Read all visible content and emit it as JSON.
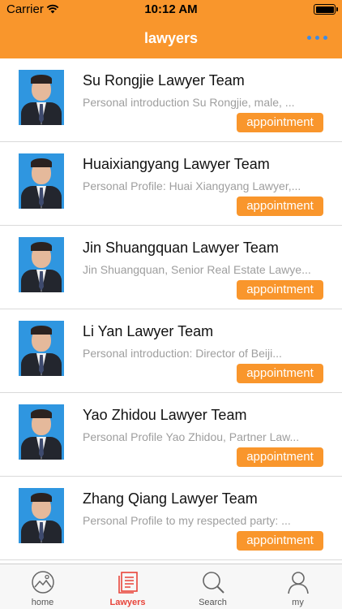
{
  "status_bar": {
    "carrier": "Carrier",
    "time": "10:12 AM"
  },
  "nav": {
    "title": "lawyers",
    "more_icon": "ellipsis-icon"
  },
  "lawyers": [
    {
      "name": "Su Rongjie Lawyer Team",
      "intro": "Personal introduction Su Rongjie, male, ...",
      "button": "appointment"
    },
    {
      "name": "Huaixiangyang Lawyer Team",
      "intro": "Personal Profile: Huai Xiangyang Lawyer,...",
      "button": "appointment"
    },
    {
      "name": "Jin Shuangquan Lawyer Team",
      "intro": "Jin Shuangquan, Senior Real Estate Lawye...",
      "button": "appointment"
    },
    {
      "name": "Li Yan Lawyer Team",
      "intro": "Personal introduction: Director of Beiji...",
      "button": "appointment"
    },
    {
      "name": "Yao Zhidou Lawyer Team",
      "intro": "Personal Profile Yao Zhidou, Partner Law...",
      "button": "appointment"
    },
    {
      "name": "Zhang Qiang Lawyer Team",
      "intro": "Personal Profile to my respected party: ...",
      "button": "appointment"
    }
  ],
  "tabbar": {
    "home": "home",
    "lawyers": "Lawyers",
    "search": "Search",
    "my": "my",
    "active": "Lawyers"
  },
  "colors": {
    "accent": "#F9962C",
    "active_tab": "#E8443A",
    "more_dots": "#3C8CE7"
  }
}
